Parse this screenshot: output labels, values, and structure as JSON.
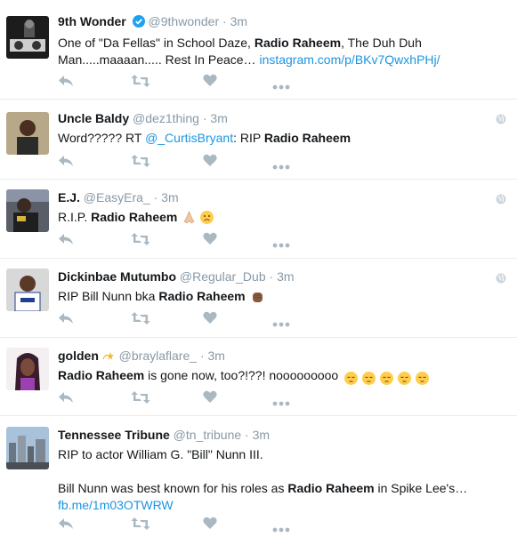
{
  "icons": {
    "reply": "reply-icon",
    "retweet": "retweet-icon",
    "like": "heart-icon",
    "more": "more-icon",
    "verified": "verified-badge-icon",
    "globe": "globe-icon"
  },
  "colors": {
    "link": "#1b95e0",
    "muted": "#8899a6",
    "verified": "#1da1f2"
  },
  "tweets": [
    {
      "name": "9th Wonder",
      "handle": "@9thwonder",
      "sep": "·",
      "time": "3m",
      "verified": true,
      "text_a": "One of \"Da Fellas\" in School Daze, ",
      "bold_a": "Radio Raheem",
      "text_b": ", The Duh Duh Man.....maaaan..... Rest In Peace… ",
      "link": "instagram.com/p/BKv7QwxhPHj/"
    },
    {
      "name": "Uncle Baldy",
      "handle": "@dez1thing",
      "sep": "·",
      "time": "3m",
      "text_a": "Word????? RT ",
      "mention": "@_CurtisBryant",
      "text_b": ": RIP ",
      "bold_a": "Radio Raheem"
    },
    {
      "name": "E.J.",
      "handle": "@EasyEra_",
      "sep": "·",
      "time": "3m",
      "text_a": "R.I.P. ",
      "bold_a": "Radio Raheem"
    },
    {
      "name": "Dickinbae Mutumbo",
      "handle": "@Regular_Dub",
      "sep": "·",
      "time": "3m",
      "text_a": "RIP Bill Nunn bka ",
      "bold_a": "Radio Raheem"
    },
    {
      "name": "golden",
      "handle": "@braylaflare_",
      "sep": "·",
      "time": "3m",
      "bold_a": "Radio Raheem",
      "text_a": " is gone now, too?!??! nooooooooo"
    },
    {
      "name": "Tennessee Tribune",
      "handle": "@tn_tribune",
      "sep": "·",
      "time": "3m",
      "line1": "RIP to actor William G. \"Bill\" Nunn III.",
      "text_a": "Bill Nunn was best known for his roles as ",
      "bold_a": "Radio Raheem",
      "text_b": " in Spike Lee's…",
      "link": "fb.me/1m03OTWRW"
    }
  ]
}
